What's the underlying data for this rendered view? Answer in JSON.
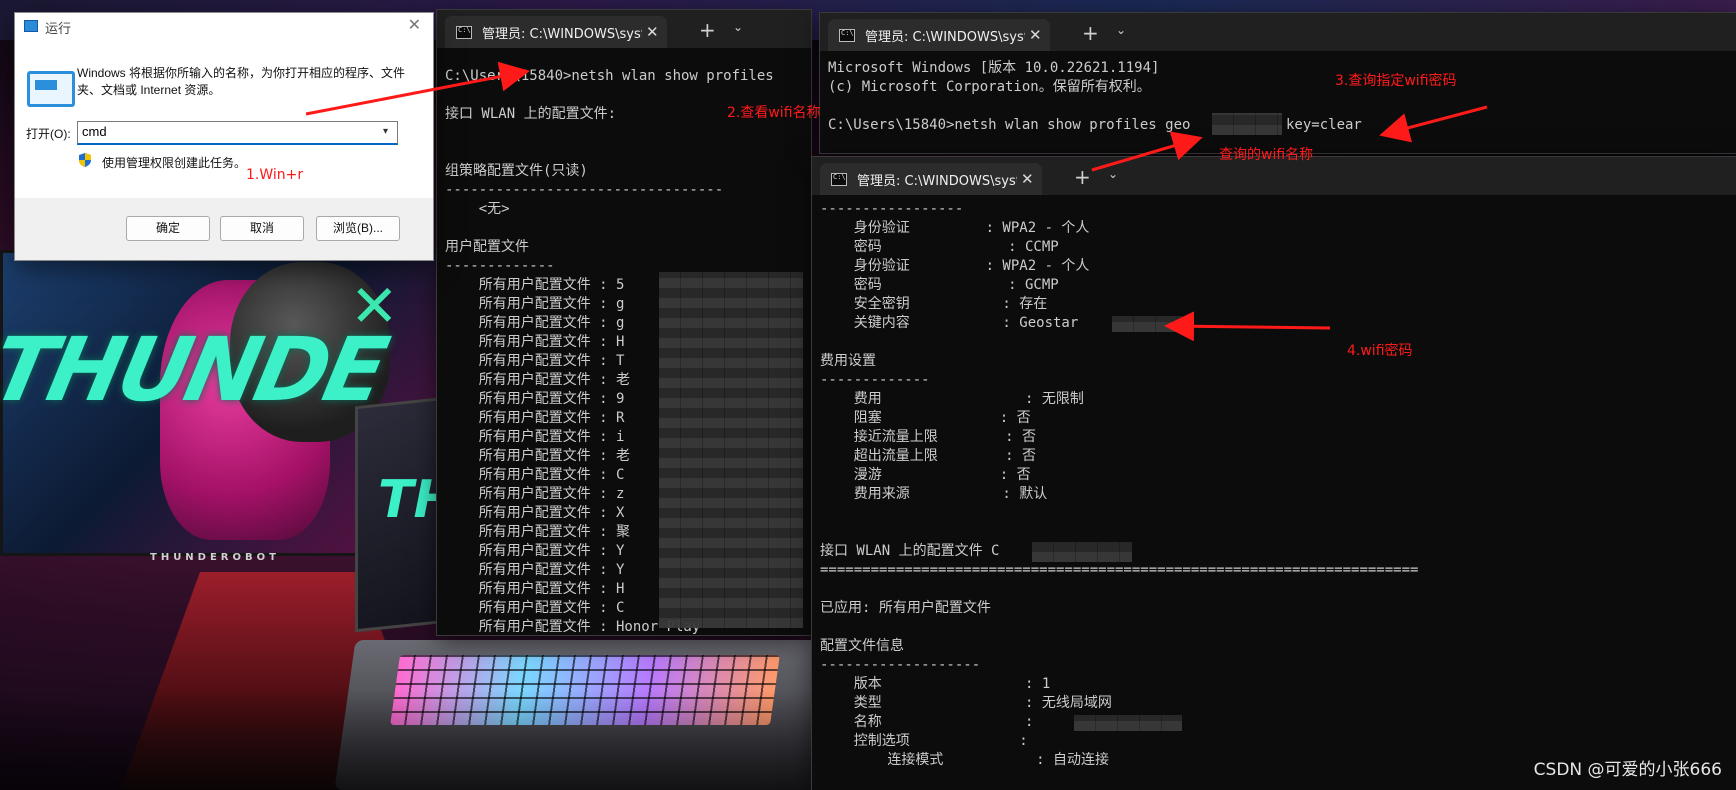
{
  "run_dialog": {
    "title": "运行",
    "description": "Windows 将根据你所输入的名称，为你打开相应的程序、文件夹、文档或 Internet 资源。",
    "open_label": "打开(O):",
    "input_value": "cmd",
    "admin_text": "使用管理权限创建此任务。",
    "ok_label": "确定",
    "cancel_label": "取消",
    "browse_label": "浏览(B)..."
  },
  "terminal1": {
    "tab_title": "管理员: C:\\WINDOWS\\system",
    "lines": [
      "C:\\Users\\15840>netsh wlan show profiles",
      "",
      "接口 WLAN 上的配置文件:",
      "",
      "",
      "组策略配置文件(只读)",
      "---------------------------------",
      "    <无>",
      "",
      "用户配置文件",
      "-------------",
      "    所有用户配置文件 : 5",
      "    所有用户配置文件 : g",
      "    所有用户配置文件 : g",
      "    所有用户配置文件 : H",
      "    所有用户配置文件 : T",
      "    所有用户配置文件 : 老",
      "    所有用户配置文件 : 9",
      "    所有用户配置文件 : R",
      "    所有用户配置文件 : i",
      "    所有用户配置文件 : 老",
      "    所有用户配置文件 : C",
      "    所有用户配置文件 : z",
      "    所有用户配置文件 : X",
      "    所有用户配置文件 : 聚",
      "    所有用户配置文件 : Y",
      "    所有用户配置文件 : Y",
      "    所有用户配置文件 : H",
      "    所有用户配置文件 : C",
      "    所有用户配置文件 : Honor Play"
    ]
  },
  "terminal2": {
    "tab_title": "管理员: C:\\WINDOWS\\system",
    "lines": [
      "Microsoft Windows [版本 10.0.22621.1194]",
      "(c) Microsoft Corporation。保留所有权利。",
      "",
      "C:\\Users\\15840>netsh wlan show profiles geo",
      "key=clear"
    ]
  },
  "terminal3": {
    "tab_title": "管理员: C:\\WINDOWS\\system",
    "lines": [
      "-----------------",
      "    身份验证         : WPA2 - 个人",
      "    密码               : CCMP",
      "    身份验证         : WPA2 - 个人",
      "    密码               : GCMP",
      "    安全密钥           : 存在",
      "    关键内容           : Geostar",
      "",
      "费用设置",
      "-------------",
      "    费用                 : 无限制",
      "    阻塞              : 否",
      "    接近流量上限        : 否",
      "    超出流量上限        : 否",
      "    漫游              : 否",
      "    费用来源           : 默认",
      "",
      "",
      "接口 WLAN 上的配置文件 C",
      "=======================================================================",
      "",
      "已应用: 所有用户配置文件",
      "",
      "配置文件信息",
      "-------------------",
      "    版本                 : 1",
      "    类型                 : 无线局域网",
      "    名称                 :",
      "    控制选项             :",
      "        连接模式           : 自动连接"
    ]
  },
  "annotations": {
    "step1": "1.Win+r",
    "step2": "2.查看wifi名称",
    "step3": "3.查询指定wifi密码",
    "step3_sub": "查询的wifi名称",
    "step4": "4.wifi密码"
  },
  "wallpaper": {
    "logo_text": "THUNDE",
    "tablet_text": "TH",
    "brand": "THUNDEROBOT"
  },
  "watermark": "CSDN @可爱的小张666",
  "colors": {
    "annotation": "#ff1a1a",
    "terminal_bg": "#0c0c0c",
    "terminal_fg": "#cccccc"
  }
}
